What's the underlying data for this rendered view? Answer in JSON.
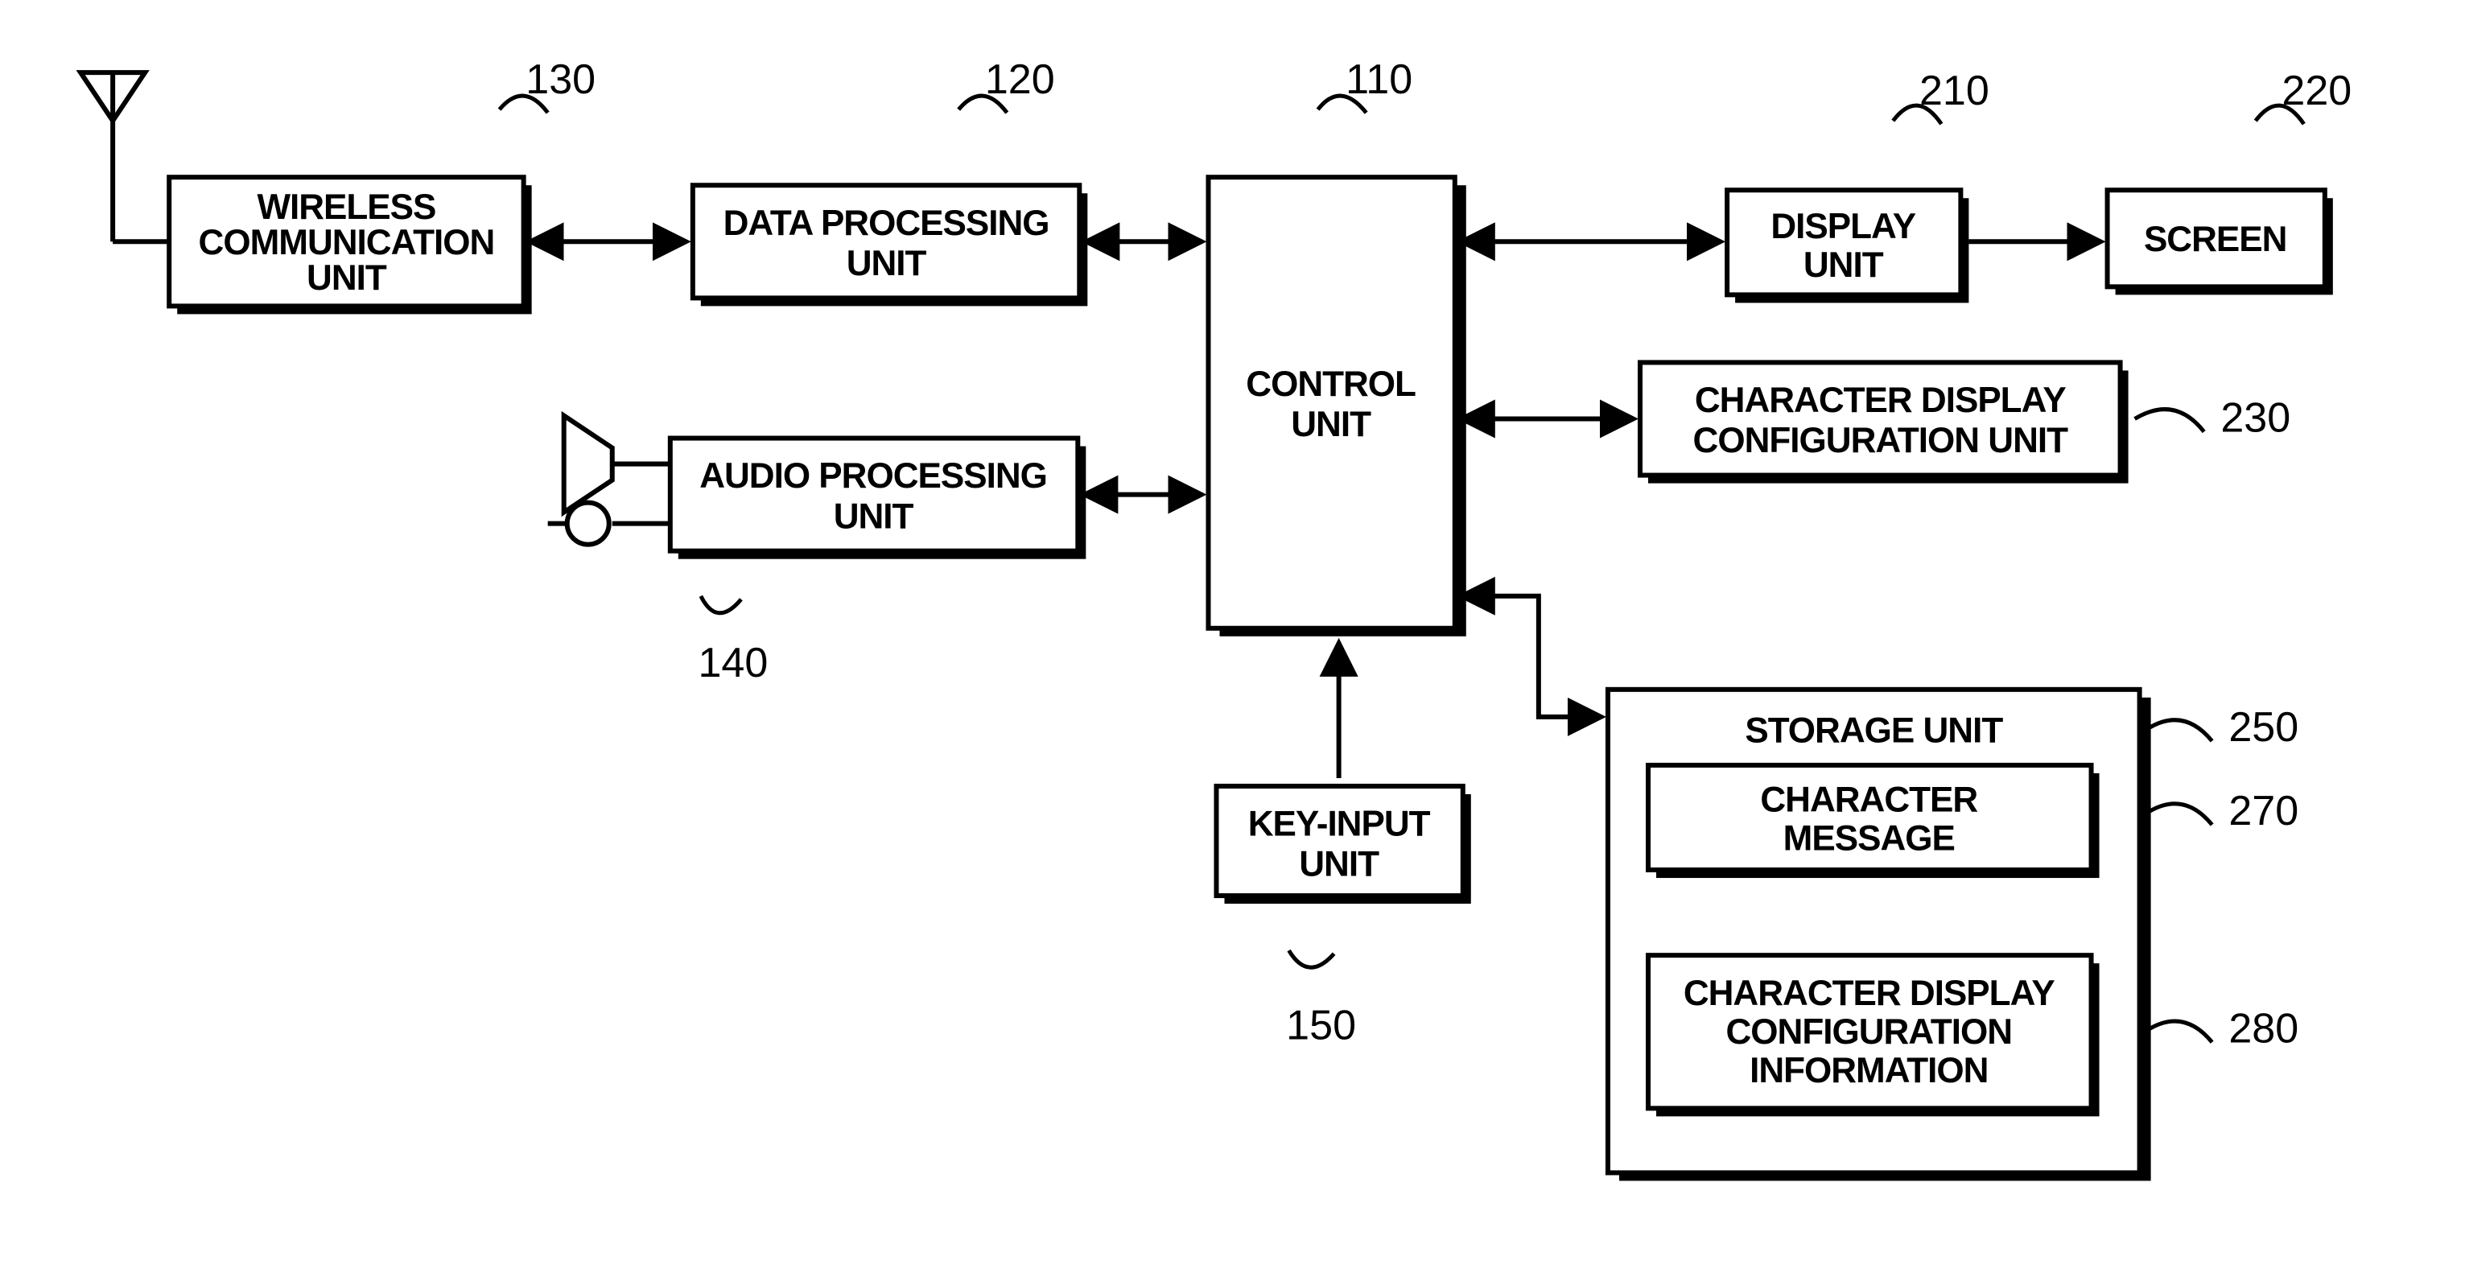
{
  "blocks": {
    "wireless": {
      "l1": "WIRELESS",
      "l2": "COMMUNICATION",
      "l3": "UNIT",
      "ref": "130"
    },
    "dataproc": {
      "l1": "DATA PROCESSING",
      "l2": "UNIT",
      "ref": "120"
    },
    "audio": {
      "l1": "AUDIO PROCESSING",
      "l2": "UNIT",
      "ref": "140"
    },
    "control": {
      "l1": "CONTROL",
      "l2": "UNIT",
      "ref": "110"
    },
    "keyin": {
      "l1": "KEY-INPUT",
      "l2": "UNIT",
      "ref": "150"
    },
    "display": {
      "l1": "DISPLAY",
      "l2": "UNIT",
      "ref": "210"
    },
    "screen": {
      "l1": "SCREEN",
      "ref": "220"
    },
    "cdcu": {
      "l1": "CHARACTER DISPLAY",
      "l2": "CONFIGURATION UNIT",
      "ref": "230"
    },
    "storage": {
      "title": "STORAGE UNIT",
      "ref": "250"
    },
    "cmsg": {
      "l1": "CHARACTER",
      "l2": "MESSAGE",
      "ref": "270"
    },
    "cdci": {
      "l1": "CHARACTER DISPLAY",
      "l2": "CONFIGURATION",
      "l3": "INFORMATION",
      "ref": "280"
    }
  }
}
